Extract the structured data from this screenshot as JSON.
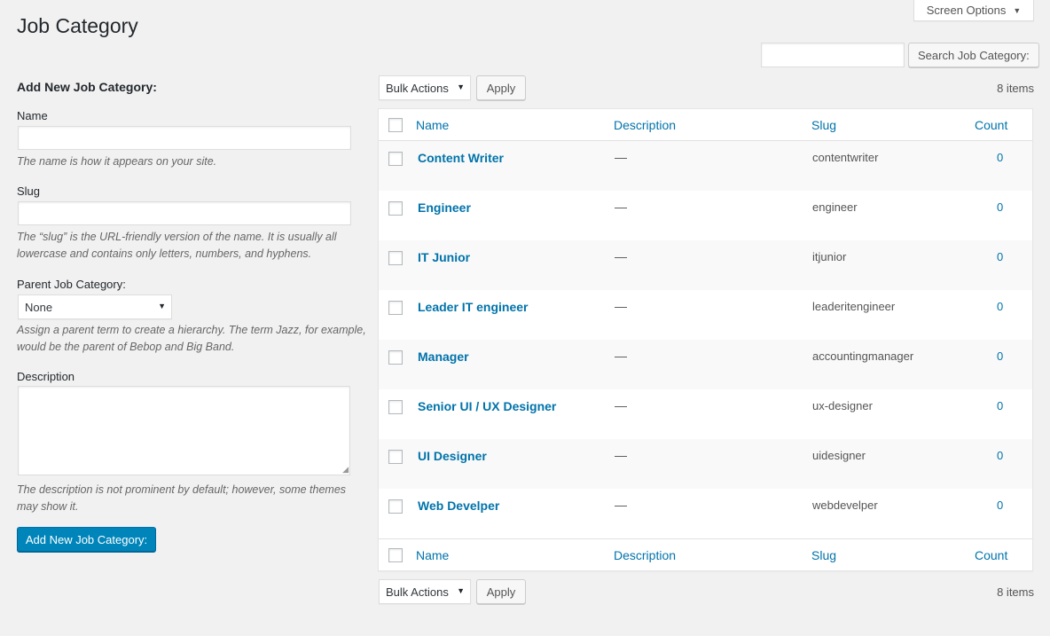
{
  "screen_options": {
    "label": "Screen Options",
    "arrow_icon": "▼"
  },
  "page_title": "Job Category",
  "search": {
    "button_label": "Search Job Category:",
    "value": ""
  },
  "form": {
    "heading": "Add New Job Category:",
    "name_label": "Name",
    "name_value": "",
    "name_hint": "The name is how it appears on your site.",
    "slug_label": "Slug",
    "slug_value": "",
    "slug_hint_line1": "The “slug” is the URL-friendly version of the name. It is usually all",
    "slug_hint_line2": "lowercase and contains only letters, numbers, and hyphens.",
    "parent_label": "Parent Job Category:",
    "parent_selected": "None",
    "parent_hint_line1": "Assign a parent term to create a hierarchy. The term Jazz, for example,",
    "parent_hint_line2": "would be the parent of Bebop and Big Band.",
    "description_label": "Description",
    "description_value": "",
    "description_hint_line1": "The description is not prominent by default; however, some themes",
    "description_hint_line2": "may show it.",
    "submit_label": "Add New Job Category:"
  },
  "list": {
    "bulk_actions_label": "Bulk Actions",
    "apply_label": "Apply",
    "items_count": "8 items",
    "columns": {
      "name": "Name",
      "description": "Description",
      "slug": "Slug",
      "count": "Count"
    },
    "rows": [
      {
        "name": "Content Writer",
        "description": "—",
        "slug": "contentwriter",
        "count": "0"
      },
      {
        "name": "Engineer",
        "description": "—",
        "slug": "engineer",
        "count": "0"
      },
      {
        "name": "IT Junior",
        "description": "—",
        "slug": "itjunior",
        "count": "0"
      },
      {
        "name": "Leader IT engineer",
        "description": "—",
        "slug": "leaderitengineer",
        "count": "0"
      },
      {
        "name": "Manager",
        "description": "—",
        "slug": "accountingmanager",
        "count": "0"
      },
      {
        "name": "Senior UI / UX Designer",
        "description": "—",
        "slug": "ux-designer",
        "count": "0"
      },
      {
        "name": "UI Designer",
        "description": "—",
        "slug": "uidesigner",
        "count": "0"
      },
      {
        "name": "Web Develper",
        "description": "—",
        "slug": "webdevelper",
        "count": "0"
      }
    ]
  },
  "colors": {
    "link": "#0073aa",
    "primary_button": "#0085ba",
    "background": "#f1f1f1"
  }
}
